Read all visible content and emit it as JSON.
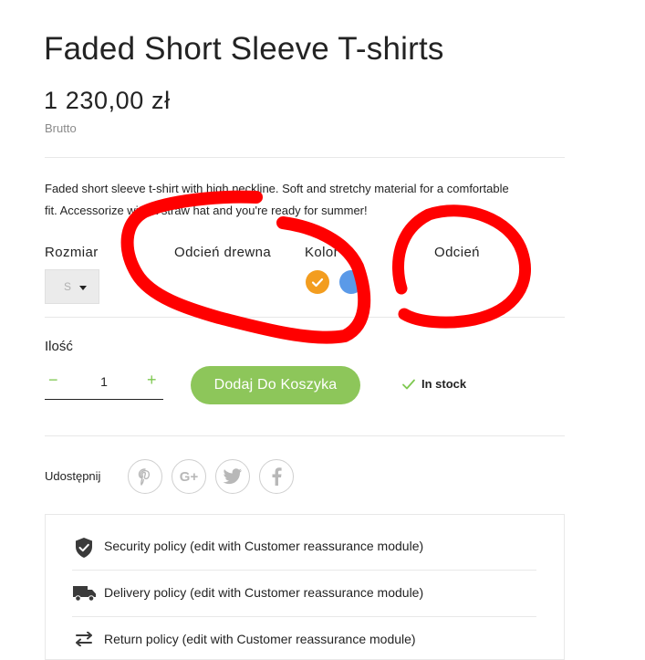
{
  "product": {
    "title": "Faded Short Sleeve T-shirts",
    "price": "1 230,00 zł",
    "tax_label": "Brutto",
    "description": "Faded short sleeve t-shirt with high neckline. Soft and stretchy material for a comfortable fit. Accessorize with a straw hat and you're ready for summer!"
  },
  "variants": {
    "size_label": "Rozmiar",
    "size_value": "S",
    "wood_shade_label": "Odcień drewna",
    "color_label": "Kolor",
    "shade_label": "Odcień",
    "colors": [
      {
        "name": "orange",
        "hex": "#f39d1f",
        "selected": true
      },
      {
        "name": "blue",
        "hex": "#5b9ae8",
        "selected": false
      }
    ]
  },
  "quantity": {
    "label": "Ilość",
    "minus": "−",
    "value": "1",
    "plus": "+"
  },
  "cart": {
    "add_button": "Dodaj Do Koszyka",
    "stock_status": "In stock"
  },
  "share": {
    "label": "Udostępnij",
    "buttons": [
      {
        "icon": "pinterest-icon",
        "glyph": "P"
      },
      {
        "icon": "google-plus-icon",
        "glyph": "G+"
      },
      {
        "icon": "twitter-icon",
        "glyph": "t"
      },
      {
        "icon": "facebook-icon",
        "glyph": "f"
      }
    ]
  },
  "reassurance": [
    {
      "icon": "shield-icon",
      "text": "Security policy (edit with Customer reassurance module)"
    },
    {
      "icon": "truck-icon",
      "text": "Delivery policy (edit with Customer reassurance module)"
    },
    {
      "icon": "return-arrows-icon",
      "text": "Return policy (edit with Customer reassurance module)"
    }
  ],
  "colors": {
    "accent_green": "#8dc65a",
    "scribble_red": "#ff0000",
    "text": "#232323"
  }
}
